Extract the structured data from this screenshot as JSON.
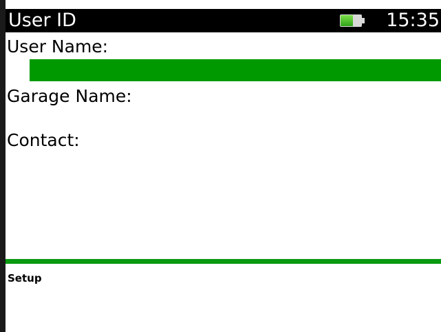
{
  "header": {
    "title": "User ID",
    "time": "15:35",
    "battery_level": 0.6,
    "battery_icon": "battery-icon"
  },
  "fields": {
    "user_name_label": "User Name:",
    "user_name_value": "",
    "garage_name_label": "Garage Name:",
    "contact_label": "Contact:"
  },
  "softkeys": {
    "left_label": "Setup"
  },
  "colors": {
    "titlebar": "#000000",
    "selection": "#009a00",
    "divider": "#0a9a12"
  }
}
